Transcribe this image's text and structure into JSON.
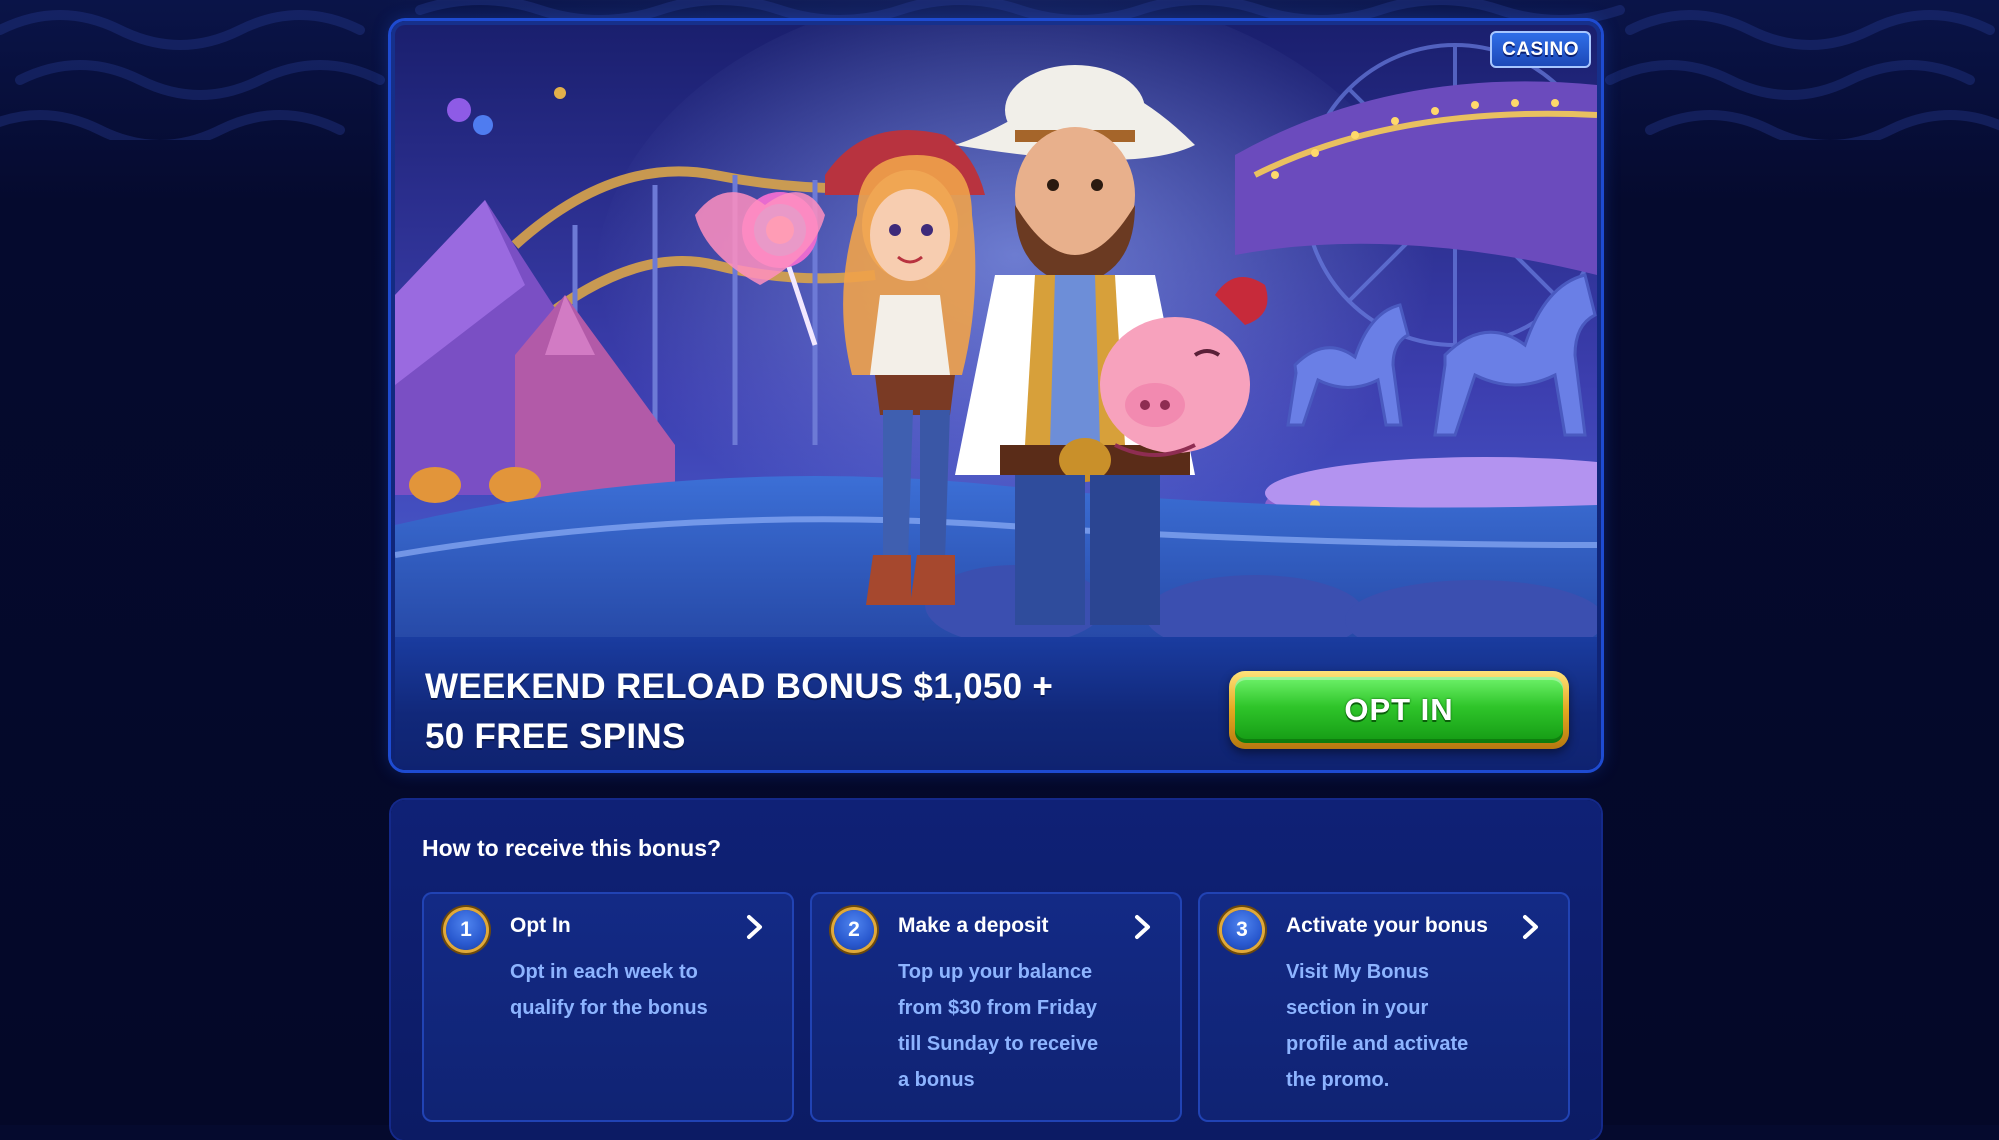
{
  "promo": {
    "badge": "CASINO",
    "title_line1": "WEEKEND RELOAD BONUS $1,050 +",
    "title_line2": "50 FREE SPINS",
    "opt_in_label": "OPT IN"
  },
  "howto": {
    "title": "How to receive this bonus?",
    "steps": [
      {
        "number": "1",
        "title": "Opt In",
        "desc_lines": [
          "Opt in each week to",
          "qualify for the bonus"
        ]
      },
      {
        "number": "2",
        "title": "Make a deposit",
        "desc_lines": [
          "Top up your balance",
          "from $30 from Friday",
          "till Sunday to receive",
          "a bonus"
        ]
      },
      {
        "number": "3",
        "title": "Activate your bonus",
        "desc_lines": [
          "Visit My Bonus",
          "section in your",
          "profile and activate",
          "the promo."
        ]
      }
    ]
  },
  "colors": {
    "page_bg": "#050a2e",
    "card_border": "#1e4bd1",
    "button_green": "#2fc52a",
    "button_gold": "#e3a820",
    "desc_text": "#8db4ff"
  }
}
